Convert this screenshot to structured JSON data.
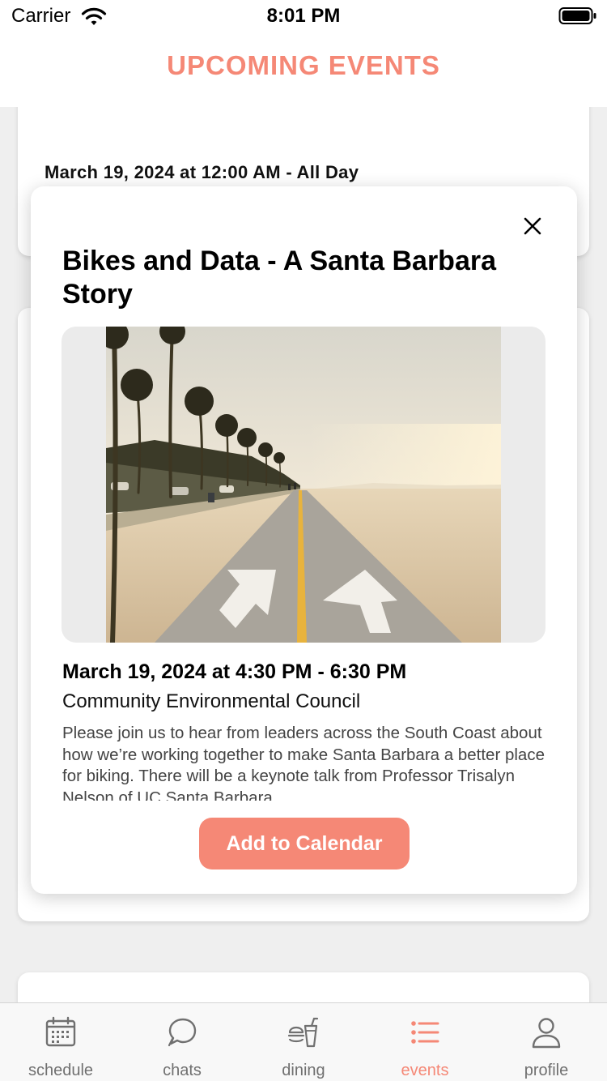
{
  "colors": {
    "accent": "#f58876",
    "inactive": "#707070",
    "text": "#000000"
  },
  "status_bar": {
    "carrier": "Carrier",
    "time": "8:01 PM",
    "wifi_icon": "wifi-icon",
    "battery_icon": "battery-icon"
  },
  "header": {
    "title": "UPCOMING EVENTS"
  },
  "background_card": {
    "date": "March 19, 2024 at 12:00 AM - All Day"
  },
  "modal": {
    "close_icon": "close-icon",
    "title": "Bikes and Data - A Santa Barbara Story",
    "image_description_icon": "beach-bike-path-photo",
    "date": "March 19, 2024 at 4:30 PM - 6:30 PM",
    "organization": "Community Environmental Council",
    "description": "Please join us to hear from leaders across the South Coast about how we’re working together to make Santa Barbara a better place for biking. There will be a keynote talk from Professor Trisalyn Nelson of UC Santa Barbara",
    "button_label": "Add to Calendar"
  },
  "tabs": [
    {
      "label": "schedule",
      "icon": "calendar-icon",
      "active": false
    },
    {
      "label": "chats",
      "icon": "chat-bubble-icon",
      "active": false
    },
    {
      "label": "dining",
      "icon": "burger-drink-icon",
      "active": false
    },
    {
      "label": "events",
      "icon": "list-icon",
      "active": true
    },
    {
      "label": "profile",
      "icon": "person-icon",
      "active": false
    }
  ]
}
